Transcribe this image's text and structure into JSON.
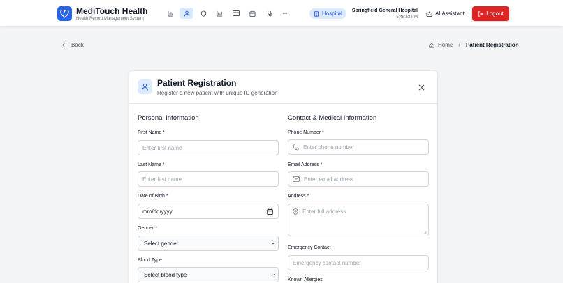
{
  "app": {
    "title": "MediTouch Health",
    "subtitle": "Health Record Management System",
    "brand_color": "#2563eb"
  },
  "nav": {
    "icons": [
      "chart-icon",
      "user-icon",
      "shield-icon",
      "bar-chart-icon",
      "card-icon",
      "calendar-icon",
      "stethoscope-icon",
      "more-icon"
    ],
    "more_label": "···"
  },
  "header": {
    "hospital_badge": "Hospital",
    "hospital_name": "Springfield General Hospital",
    "time": "5:45:53 PM",
    "ai_label": "AI Assistant",
    "logout_label": "Logout",
    "logout_color": "#dc2626"
  },
  "breadcrumb": {
    "back_label": "Back",
    "home_label": "Home",
    "separator": "›",
    "current": "Patient Registration"
  },
  "card": {
    "title": "Patient Registration",
    "subtitle": "Register a new patient with unique ID generation"
  },
  "personal": {
    "section_title": "Personal Information",
    "first_name_label": "First Name *",
    "first_name_placeholder": "Enter first name",
    "last_name_label": "Last Name *",
    "last_name_placeholder": "Enter last name",
    "dob_label": "Date of Birth *",
    "dob_value": "mm/dd/yyyy",
    "gender_label": "Gender *",
    "gender_value": "Select gender",
    "blood_label": "Blood Type",
    "blood_value": "Select blood type"
  },
  "contact": {
    "section_title": "Contact & Medical Information",
    "phone_label": "Phone Number *",
    "phone_placeholder": "Enter phone number",
    "email_label": "Email Address *",
    "email_placeholder": "Enter email address",
    "address_label": "Address *",
    "address_placeholder": "Enter full address",
    "emergency_label": "Emergency Contact",
    "emergency_placeholder": "Emergency contact number",
    "allergies_label": "Known Allergies"
  }
}
